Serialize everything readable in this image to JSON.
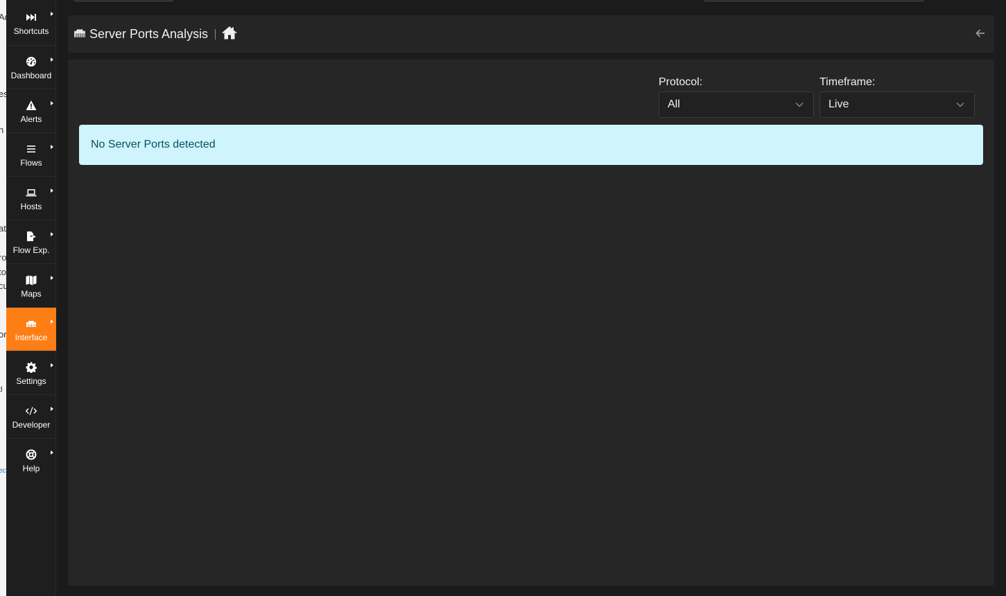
{
  "background_window": {
    "fragments": [
      "Ad",
      "es",
      "n",
      "at",
      "ro",
      "to",
      "cu",
      "or",
      "d",
      "ec"
    ]
  },
  "sidebar": {
    "items": [
      {
        "label": "Shortcuts",
        "icon": "fast-forward-icon"
      },
      {
        "label": "Dashboard",
        "icon": "gauge-icon"
      },
      {
        "label": "Alerts",
        "icon": "warning-icon"
      },
      {
        "label": "Flows",
        "icon": "bars-icon"
      },
      {
        "label": "Hosts",
        "icon": "laptop-icon"
      },
      {
        "label": "Flow Exp.",
        "icon": "file-export-icon"
      },
      {
        "label": "Maps",
        "icon": "map-icon"
      },
      {
        "label": "Interface",
        "icon": "ethernet-icon",
        "active": true
      },
      {
        "label": "Settings",
        "icon": "gear-icon"
      },
      {
        "label": "Developer",
        "icon": "code-icon"
      },
      {
        "label": "Help",
        "icon": "life-ring-icon"
      }
    ],
    "active_color": "#fd7e14"
  },
  "header": {
    "title": "Server Ports Analysis",
    "title_icon": "ethernet-icon",
    "home_icon": "home-icon",
    "back_icon": "arrow-left-icon"
  },
  "filters": {
    "protocol": {
      "label": "Protocol:",
      "value": "All"
    },
    "timeframe": {
      "label": "Timeframe:",
      "value": "Live"
    }
  },
  "alert": {
    "message": "No Server Ports detected",
    "background": "#cff4fc",
    "text_color": "#055160"
  }
}
